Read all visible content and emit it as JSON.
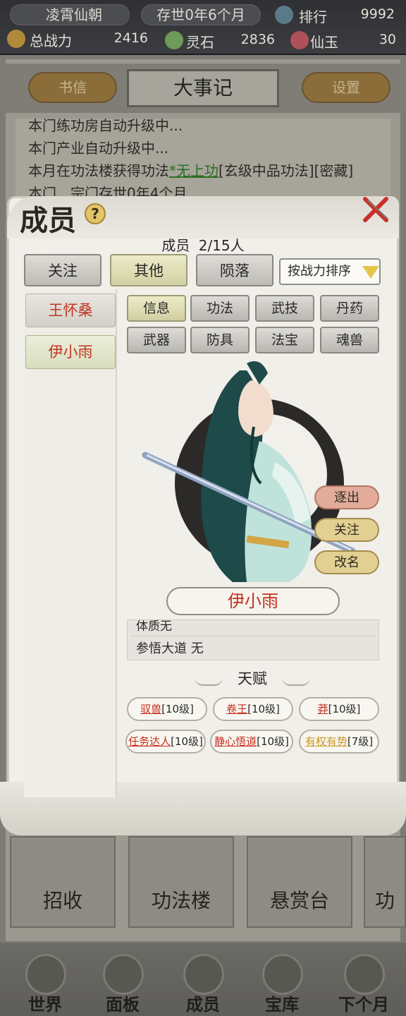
{
  "top_bar": {
    "sect_name": "凌霄仙朝",
    "age": "存世0年6个月",
    "rank_label": "排行",
    "rank_value": "9992",
    "power_label": "总战力",
    "power_value": "2416",
    "spirit_stone_label": "灵石",
    "spirit_stone_value": "2836",
    "jade_label": "仙玉",
    "jade_value": "30"
  },
  "header": {
    "letters_label": "书信",
    "title": "大事记",
    "settings_label": "设置"
  },
  "log": {
    "lines": [
      "本门练功房自动升级中...",
      "本门产业自动升级中...",
      "本月在功法楼获得功法",
      "本门…宗门存世0年4个月"
    ],
    "line3_highlight": "*无上功",
    "line3_suffix": "[玄级中品功法][密藏]"
  },
  "modal": {
    "title": "成员",
    "help_symbol": "?",
    "count_label": "成员",
    "count_value": "2/15人",
    "filters": [
      "关注",
      "其他",
      "陨落"
    ],
    "active_filter": "其他",
    "sort_label": "按战力排序",
    "members": [
      "王怀桑",
      "伊小雨"
    ],
    "selected_member": "伊小雨",
    "tabs": [
      "信息",
      "功法",
      "武技",
      "丹药",
      "武器",
      "防具",
      "法宝",
      "魂兽"
    ],
    "active_tab": "信息",
    "actions": [
      "逐出",
      "关注",
      "改名"
    ],
    "character_name": "伊小雨",
    "attr_cut": "体质无",
    "attr_line": "参悟大道 无",
    "talent_title": "天赋",
    "talents": [
      {
        "name": "驭兽",
        "level": "[10级]"
      },
      {
        "name": "卷王",
        "level": "[10级]"
      },
      {
        "name": "莽",
        "level": "[10级]"
      },
      {
        "name": "任务达人",
        "level": "[10级]"
      },
      {
        "name": "静心悟道",
        "level": "[10级]"
      },
      {
        "name": "有权有势",
        "level": "[7级]"
      }
    ]
  },
  "bg_cards": [
    "招收",
    "功法楼",
    "悬赏台",
    "功"
  ],
  "bottom_nav": [
    "世界",
    "面板",
    "成员",
    "宝库",
    "下个月"
  ],
  "colors": {
    "member_name_red": "#c23422",
    "talent_red": "#c8301f",
    "talent_gold": "#c99a1e",
    "active_green": "#d2d1a4"
  }
}
